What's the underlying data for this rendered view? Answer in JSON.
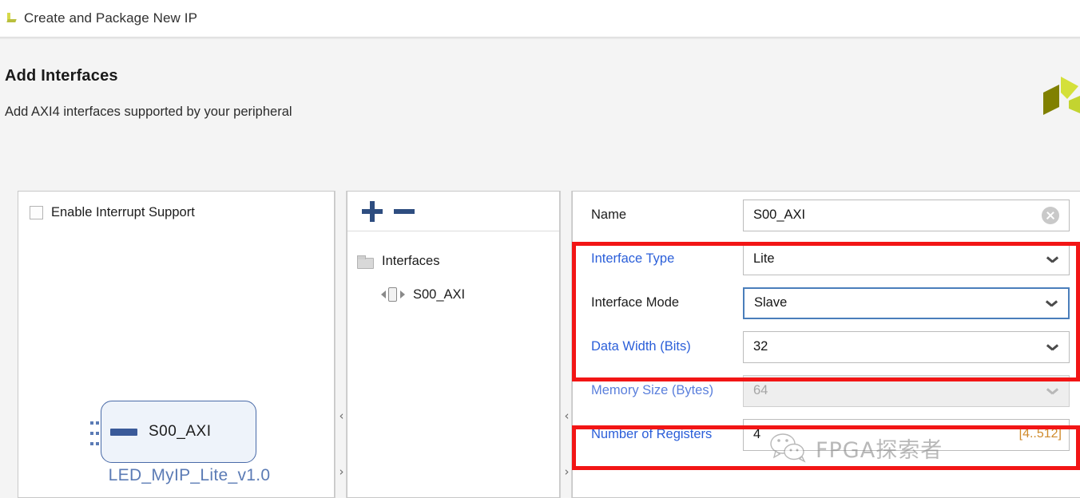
{
  "window": {
    "title": "Create and Package New IP",
    "icon": "vivado-wizard-icon"
  },
  "header": {
    "title": "Add Interfaces",
    "subtitle": "Add AXI4 interfaces supported by your peripheral",
    "brand_logo": "xilinx-logo"
  },
  "left_panel": {
    "interrupt_checkbox": {
      "label": "Enable Interrupt Support",
      "checked": false
    },
    "ip_block": {
      "port_label": "S00_AXI",
      "caption": "LED_MyIP_Lite_v1.0"
    }
  },
  "tree_panel": {
    "toolbar": {
      "add_label": "+",
      "remove_label": "−"
    },
    "nodes": [
      {
        "label": "Interfaces",
        "icon": "folder-icon"
      },
      {
        "label": "S00_AXI",
        "icon": "interface-icon"
      }
    ]
  },
  "properties": {
    "name": {
      "label": "Name",
      "value": "S00_AXI",
      "clear_icon": "clear-circle-icon"
    },
    "interface_type": {
      "label": "Interface Type",
      "value": "Lite"
    },
    "interface_mode": {
      "label": "Interface Mode",
      "value": "Slave"
    },
    "data_width": {
      "label": "Data Width (Bits)",
      "value": "32"
    },
    "memory_size": {
      "label": "Memory Size (Bytes)",
      "value": "64"
    },
    "number_of_registers": {
      "label": "Number of Registers",
      "value": "4",
      "range_hint": "[4..512]"
    }
  },
  "splitters": {
    "collapse_up": "‹",
    "collapse_down": "›"
  },
  "watermark": {
    "text": "FPGA探索者",
    "logo": "wechat-icon"
  },
  "colors": {
    "annotation_red": "#f21515",
    "link_blue": "#2b5fd9",
    "focus_blue": "#4a7ebb",
    "page_background": "#f4f4f4"
  }
}
